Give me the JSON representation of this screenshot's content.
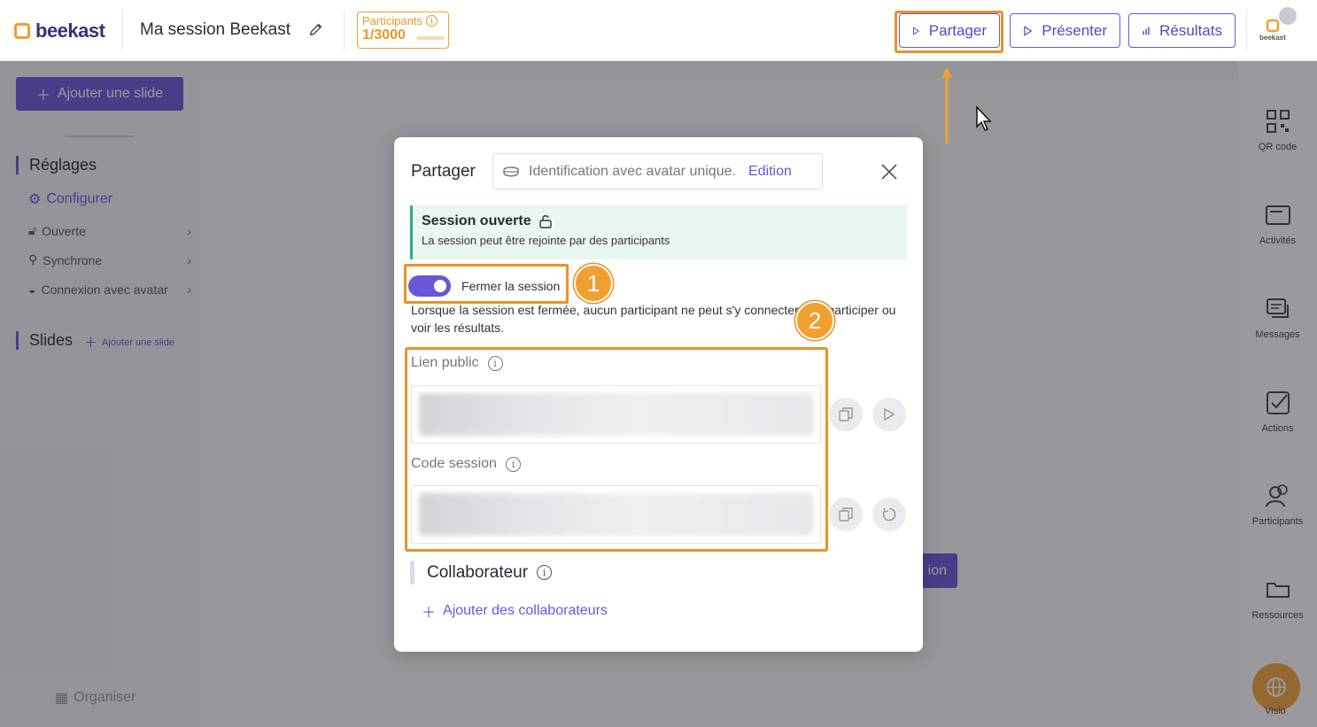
{
  "topbar": {
    "brand": "beekast",
    "session_title": "Ma session Beekast",
    "participants_label": "Participants",
    "participants_value": "1/3000",
    "share_label": "Partager",
    "present_label": "Présenter",
    "results_label": "Résultats",
    "avatar_brand": "beekast"
  },
  "left_sidebar": {
    "add_slide_label": "Ajouter une slide",
    "settings_title": "Réglages",
    "configure_label": "Configurer",
    "options": [
      "Ouverte",
      "Synchrone",
      "Connexion avec avatar"
    ],
    "slides_title": "Slides",
    "add_slide_small": "Ajouter une slide",
    "organise_label": "Organiser"
  },
  "canvas": {
    "hidden_button_tail": "ion"
  },
  "right_sidebar": {
    "items": [
      "QR code",
      "Activités",
      "Messages",
      "Actions",
      "Participants",
      "Ressources"
    ],
    "visio_label": "Visio"
  },
  "modal": {
    "title": "Partager",
    "identification_text": "Identification avec avatar unique.",
    "identification_link": "Edition",
    "status_title": "Session ouverte",
    "status_subtitle": "La session peut être rejointe par des participants",
    "toggle_label": "Fermer la session",
    "description": "Lorsque la session est fermée, aucun participant ne peut s'y connecter, ni y participer ou voir les résultats.",
    "public_link_label": "Lien public",
    "session_code_label": "Code session",
    "collaborator_title": "Collaborateur",
    "add_collaborators": "Ajouter des collaborateurs"
  },
  "annotations": {
    "badge_1": "1",
    "badge_2": "2"
  },
  "colors": {
    "accent": "#6a56d8",
    "highlight": "#e8922a",
    "open_status": "#30b07a"
  }
}
